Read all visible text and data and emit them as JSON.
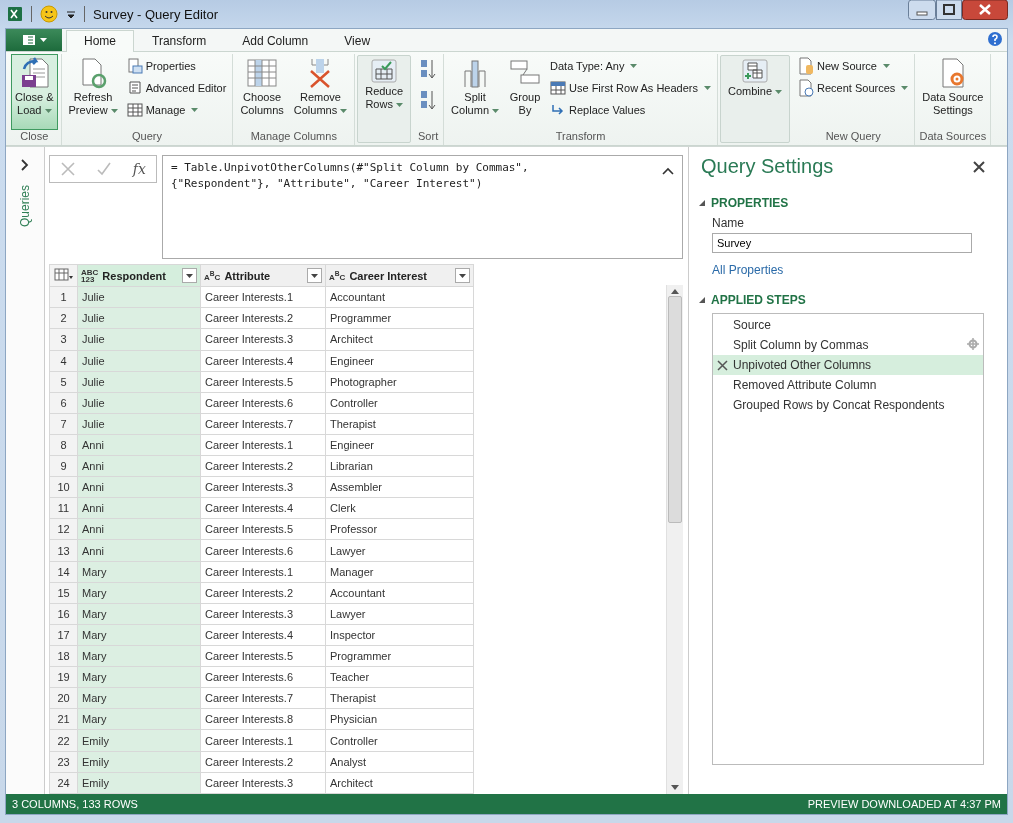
{
  "window": {
    "title": "Survey - Query Editor"
  },
  "ribbon": {
    "tabs": [
      {
        "label": "Home",
        "selected": true
      },
      {
        "label": "Transform",
        "selected": false
      },
      {
        "label": "Add Column",
        "selected": false
      },
      {
        "label": "View",
        "selected": false
      }
    ],
    "groups": [
      {
        "label": "Close",
        "collapsed": false,
        "items": [
          {
            "label": "Close &\nLoad",
            "kind": "large",
            "dropdown": true,
            "highlighted": true
          }
        ]
      },
      {
        "label": "Query",
        "collapsed": false,
        "items": [
          {
            "label": "Refresh\nPreview",
            "kind": "large",
            "dropdown": true,
            "highlighted": false
          },
          {
            "label": "Properties",
            "kind": "small",
            "dropdown": false,
            "highlighted": false
          },
          {
            "label": "Advanced Editor",
            "kind": "small",
            "dropdown": false,
            "highlighted": false
          },
          {
            "label": "Manage",
            "kind": "small",
            "dropdown": true,
            "highlighted": false
          }
        ]
      },
      {
        "label": "Manage Columns",
        "collapsed": false,
        "items": [
          {
            "label": "Choose\nColumns",
            "kind": "large",
            "dropdown": false,
            "highlighted": false
          },
          {
            "label": "Remove\nColumns",
            "kind": "large",
            "dropdown": true,
            "highlighted": false
          }
        ]
      },
      {
        "collapsed": true,
        "items": [
          {
            "label": "Reduce\nRows",
            "kind": "large",
            "dropdown": true,
            "highlighted": false
          }
        ]
      },
      {
        "label": "Sort",
        "collapsed": false,
        "items": [
          {
            "kind": "icon",
            "dropdown": false,
            "highlighted": false
          },
          {
            "kind": "icon",
            "dropdown": false,
            "highlighted": false
          }
        ]
      },
      {
        "label": "Transform",
        "collapsed": false,
        "items": [
          {
            "label": "Split\nColumn",
            "kind": "large",
            "dropdown": true,
            "highlighted": false
          },
          {
            "label": "Group\nBy",
            "kind": "large",
            "dropdown": false,
            "highlighted": false
          },
          {
            "label": "Data Type: Any",
            "kind": "small",
            "dropdown": true,
            "highlighted": false
          },
          {
            "label": "Use First Row As Headers",
            "kind": "small",
            "dropdown": true,
            "highlighted": false
          },
          {
            "label": "Replace Values",
            "kind": "small",
            "dropdown": false,
            "highlighted": false
          }
        ]
      },
      {
        "collapsed": true,
        "items": [
          {
            "label": "Combine",
            "kind": "large",
            "dropdown": true,
            "highlighted": false
          }
        ]
      },
      {
        "label": "New Query",
        "collapsed": false,
        "items": [
          {
            "label": "New Source",
            "kind": "small",
            "dropdown": true,
            "highlighted": false
          },
          {
            "label": "Recent Sources",
            "kind": "small",
            "dropdown": true,
            "highlighted": false
          }
        ]
      },
      {
        "label": "Data Sources",
        "collapsed": false,
        "items": [
          {
            "label": "Data Source\nSettings",
            "kind": "large",
            "dropdown": false,
            "highlighted": false
          }
        ]
      }
    ]
  },
  "queries_pane": {
    "label": "Queries"
  },
  "formula_bar": {
    "fx_label": "fx",
    "formula": "= Table.UnpivotOtherColumns(#\"Split Column by Commas\",\n{\"Respondent\"}, \"Attribute\", \"Career Interest\")"
  },
  "table": {
    "columns": [
      {
        "type_badge": [
          "ABC",
          "123"
        ],
        "label": "Respondent",
        "selected": true
      },
      {
        "type_badge": [
          "A$^{B}$C"
        ],
        "label": "Attribute",
        "selected": false
      },
      {
        "type_badge": [
          "A$^{B}$C"
        ],
        "label": "Career Interest",
        "selected": false
      }
    ],
    "rows": [
      {
        "number": "1",
        "cells": [
          "Julie",
          "Career Interests.1",
          "Accountant"
        ]
      },
      {
        "number": "2",
        "cells": [
          "Julie",
          "Career Interests.2",
          "Programmer"
        ]
      },
      {
        "number": "3",
        "cells": [
          "Julie",
          "Career Interests.3",
          "Architect"
        ]
      },
      {
        "number": "4",
        "cells": [
          "Julie",
          "Career Interests.4",
          "Engineer"
        ]
      },
      {
        "number": "5",
        "cells": [
          "Julie",
          "Career Interests.5",
          "Photographer"
        ]
      },
      {
        "number": "6",
        "cells": [
          "Julie",
          "Career Interests.6",
          "Controller"
        ]
      },
      {
        "number": "7",
        "cells": [
          "Julie",
          "Career Interests.7",
          "Therapist"
        ]
      },
      {
        "number": "8",
        "cells": [
          "Anni",
          "Career Interests.1",
          "Engineer"
        ]
      },
      {
        "number": "9",
        "cells": [
          "Anni",
          "Career Interests.2",
          "Librarian"
        ]
      },
      {
        "number": "10",
        "cells": [
          "Anni",
          "Career Interests.3",
          "Assembler"
        ]
      },
      {
        "number": "11",
        "cells": [
          "Anni",
          "Career Interests.4",
          "Clerk"
        ]
      },
      {
        "number": "12",
        "cells": [
          "Anni",
          "Career Interests.5",
          "Professor"
        ]
      },
      {
        "number": "13",
        "cells": [
          "Anni",
          "Career Interests.6",
          "Lawyer"
        ]
      },
      {
        "number": "14",
        "cells": [
          "Mary",
          "Career Interests.1",
          "Manager"
        ]
      },
      {
        "number": "15",
        "cells": [
          "Mary",
          "Career Interests.2",
          "Accountant"
        ]
      },
      {
        "number": "16",
        "cells": [
          "Mary",
          "Career Interests.3",
          "Lawyer"
        ]
      },
      {
        "number": "17",
        "cells": [
          "Mary",
          "Career Interests.4",
          "Inspector"
        ]
      },
      {
        "number": "18",
        "cells": [
          "Mary",
          "Career Interests.5",
          "Programmer"
        ]
      },
      {
        "number": "19",
        "cells": [
          "Mary",
          "Career Interests.6",
          "Teacher"
        ]
      },
      {
        "number": "20",
        "cells": [
          "Mary",
          "Career Interests.7",
          "Therapist"
        ]
      },
      {
        "number": "21",
        "cells": [
          "Mary",
          "Career Interests.8",
          "Physician"
        ]
      },
      {
        "number": "22",
        "cells": [
          "Emily",
          "Career Interests.1",
          "Controller"
        ]
      },
      {
        "number": "23",
        "cells": [
          "Emily",
          "Career Interests.2",
          "Analyst"
        ]
      },
      {
        "number": "24",
        "cells": [
          "Emily",
          "Career Interests.3",
          "Architect"
        ]
      }
    ]
  },
  "query_settings": {
    "title": "Query Settings",
    "properties_heading": "PROPERTIES",
    "name_label": "Name",
    "name_value": "Survey",
    "all_properties_link": "All Properties",
    "steps_heading": "APPLIED STEPS",
    "steps": [
      {
        "label": "Source",
        "selected": false,
        "has_settings": false
      },
      {
        "label": "Split Column by Commas",
        "selected": false,
        "has_settings": true
      },
      {
        "label": "Unpivoted Other Columns",
        "selected": true,
        "has_settings": false
      },
      {
        "label": "Removed Attribute Column",
        "selected": false,
        "has_settings": false
      },
      {
        "label": "Grouped Rows by Concat Respondents",
        "selected": false,
        "has_settings": false
      }
    ]
  },
  "status_bar": {
    "left": "3 COLUMNS, 133 ROWS",
    "right": "PREVIEW DOWNLOADED AT 4:37 PM"
  }
}
